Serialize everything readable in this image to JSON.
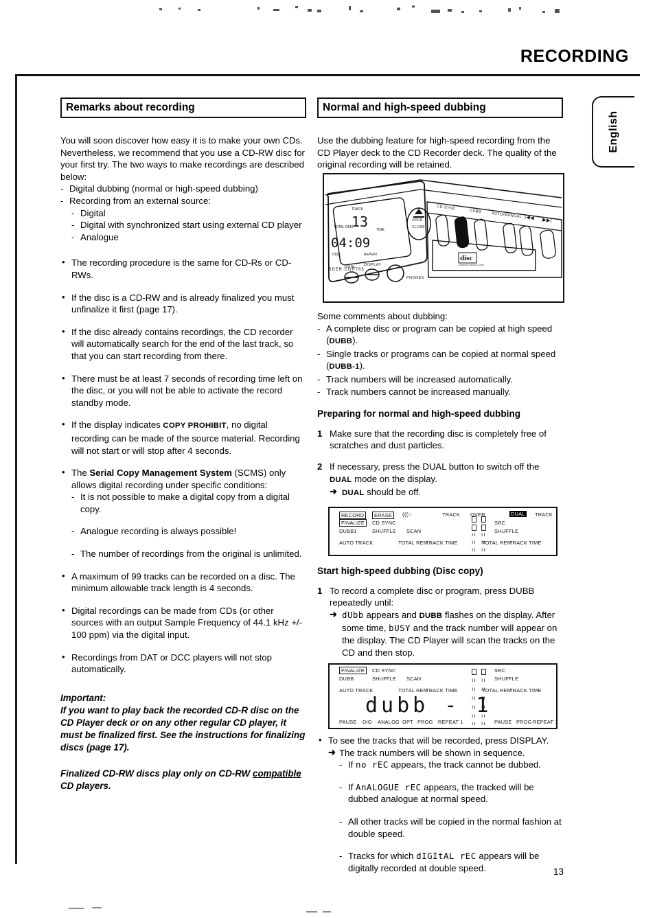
{
  "header": {
    "title": "RECORDING",
    "language_tab": "English",
    "page_number": "13"
  },
  "left": {
    "section_title": "Remarks about recording",
    "intro": "You will soon discover how easy it is to make your own CDs. Nevertheless, we recommend that you use a CD-RW disc for your first try. The two ways to make recordings are described below:",
    "ways": [
      "Digital dubbing (normal or high-speed dubbing)",
      "Recording from an external source:"
    ],
    "sub_ways": [
      "Digital",
      "Digital with synchronized start using external CD player",
      "Analogue"
    ],
    "bullets": [
      "The recording procedure is the same for CD-Rs or CD-RWs.",
      "If the disc is a CD-RW and is already finalized you must unfinalize it first (page 17).",
      "If the disc already contains recordings, the CD recorder will automatically search for the end of the last track, so that you can start recording from there.",
      "There must be at least 7 seconds of recording time left on the disc, or you will not be able to activate the record standby mode."
    ],
    "bullet_copy_prohibit_pre": "If the display indicates ",
    "bullet_copy_prohibit_sc": "COPY PROHIBIT",
    "bullet_copy_prohibit_post": ", no digital recording can be made of the source material. Recording will not start or will stop after 4 seconds.",
    "scms_pre": "The ",
    "scms_bold": "Serial Copy Management System",
    "scms_post": " (SCMS) only allows digital recording under specific conditions:",
    "scms_items": [
      "It is not possible to make a digital copy from a digital copy.",
      "Analogue recording is always possible!",
      "The number of recordings from the original is unlimited."
    ],
    "bullets_tail": [
      "A maximum of 99 tracks can be recorded on a disc. The minimum allowable track length is 4 seconds.",
      "Digital recordings can be made from CDs (or other sources with an output Sample Frequency of 44.1 kHz +/- 100 ppm) via the digital input.",
      "Recordings from DAT or DCC players will not stop automatically."
    ],
    "important_label": "Important:",
    "important_body": "If you want to play back the recorded CD-R disc on the CD Player deck or on any other regular CD player, it must be finalized first. See the instructions for finalizing discs (page 17).",
    "important_note_pre": "Finalized CD-RW discs play only on CD-RW ",
    "important_note_underline": "compatible",
    "important_note_post": " CD players."
  },
  "right": {
    "section_title": "Normal and high-speed dubbing",
    "intro": "Use the dubbing feature for high-speed recording from the CD Player deck to the CD Recorder deck. The quality of the original recording will be retained.",
    "photo": {
      "display_track_label": "TRACK",
      "display_track_value": "13",
      "display_time_label": "TIME",
      "display_time_value": "04:09",
      "display_total_rem": "TOTAL REM",
      "display_repeat": "REPEAT",
      "display_disc": "DISC",
      "brand_line": "RDER CDR765",
      "button_open_close": "OPEN CLOSE",
      "button_dual": "DUAL",
      "button_display": "DISPLAY",
      "button_phones": "PHONES",
      "top_labels": [
        "CD-SYNC",
        "DUBB",
        "AUTO/MANUAL"
      ],
      "skip_prev": "|◀◀",
      "skip_next": "▶▶|",
      "cd_logo": "compact disc digital audio"
    },
    "comments_heading": "Some comments about dubbing:",
    "comments": [
      {
        "pre": "A complete disc or program can be copied at high speed (",
        "sc": "DUBB",
        "post": ")."
      },
      {
        "pre": "Single tracks or programs can be copied at normal speed (",
        "sc": "DUBB-1",
        "post": ")."
      },
      {
        "pre": "Track numbers will be increased automatically.",
        "sc": "",
        "post": ""
      },
      {
        "pre": "Track numbers cannot be increased manually.",
        "sc": "",
        "post": ""
      }
    ],
    "preparing_heading": "Preparing for normal and high-speed dubbing",
    "step1_num": "1",
    "step1": "Make sure that the recording disc is completely free of scratches and dust particles.",
    "step2_num": "2",
    "step2_pre": "If necessary, press the DUAL button to switch off the ",
    "step2_sc": "DUAL",
    "step2_post": " mode on the display.",
    "step2_arrow_sc": "DUAL",
    "step2_arrow_post": " should be off.",
    "display1": {
      "record": "RECORD",
      "erase": "ERASE",
      "finalize": "FINALIZE",
      "cd_sync": "CD SYNC",
      "dubb1": "DUBB1",
      "shuffle": "SHUFFLE",
      "scan": "SCAN",
      "auto_track": "AUTO TRACK",
      "total_rem": "TOTAL REM",
      "track_time": "TRACK TIME",
      "track_left": "TRACK",
      "over": "OVER",
      "dual": "DUAL",
      "track_right": "TRACK",
      "src": "SRC",
      "shuffle_right": "SHUFFLE",
      "total_rem_right": "TOTAL REM",
      "track_time_right": "TRACK TIME",
      "disc_icon": "(((○"
    },
    "start_heading": "Start high-speed dubbing (Disc copy)",
    "start_step_num": "1",
    "start_step": "To record a complete disc or program, press DUBB repeatedly until:",
    "start_arrow_seg1": "dUbb",
    "start_arrow_mid1": " appears and ",
    "start_arrow_sc": "DUBB",
    "start_arrow_mid2": " flashes on the display. After some time, ",
    "start_arrow_seg2": "bUSY",
    "start_arrow_end": " and the track number will appear on the display. The CD Player will scan the tracks on the CD and then stop.",
    "display2": {
      "finalize": "FINALIZE",
      "cd_sync": "CD SYNC",
      "dubb": "DUBB",
      "shuffle": "SHUFFLE",
      "scan": "SCAN",
      "auto_track": "AUTO TRACK",
      "total_rem": "TOTAL REM",
      "track_time": "TRACK TIME",
      "main_value": "dubb - 1",
      "pause": "PAUSE",
      "dig": "DIG",
      "analog": "ANALOG",
      "opt": "OPT",
      "prog": "PROG",
      "repeat1": "REPEAT 1",
      "src": "SRC",
      "shuffle_right": "SHUFFLE",
      "total_rem_right": "TOTAL REM",
      "track_time_right": "TRACK TIME",
      "pause_right": "PAUSE",
      "prog_right": "PROG",
      "repeat1_right": "REPEAT 1"
    },
    "display_bullet": "To see the tracks that will be recorded, press DISPLAY.",
    "display_arrow": "The track numbers will be shown in sequence.",
    "display_items": [
      {
        "pre": "If ",
        "seg": "no rEC",
        "post": " appears, the track cannot be dubbed."
      },
      {
        "pre": "If ",
        "seg": "AnALOGUE rEC",
        "post": " appears, the tracked will be dubbed analogue at normal speed."
      },
      {
        "pre": "All other tracks will be copied in the normal fashion at double speed.",
        "seg": "",
        "post": ""
      },
      {
        "pre": "Tracks for which ",
        "seg": "dIGItAL rEC",
        "post": " appears will be digitally recorded at double speed."
      }
    ]
  }
}
